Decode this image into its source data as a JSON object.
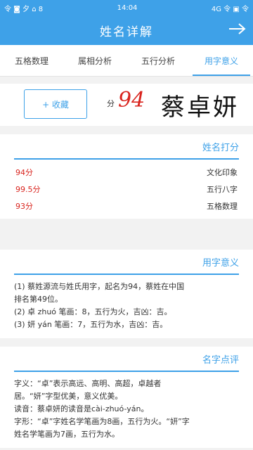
{
  "status_bar": {
    "left": "4G 令 ▣ 令",
    "time": "14:04",
    "right": "令 ◙ 夕 ⌂ 8"
  },
  "header": {
    "title": "姓名详解",
    "share_label": "⇧",
    "back_icon": "arrow-right-icon"
  },
  "tabs": [
    "用字意义",
    "五行分析",
    "属相分析",
    "五格数理"
  ],
  "name_card": {
    "favorite_label": "+ 收藏",
    "score": "94",
    "score_unit": "分",
    "name": "蔡卓妍"
  },
  "score_section": {
    "title": "姓名打分",
    "rows": [
      {
        "label": "文化印象",
        "value": "94分"
      },
      {
        "label": "五行八字",
        "value": "99.5分"
      },
      {
        "label": "五格数理",
        "value": "93分"
      }
    ]
  },
  "meaning_section": {
    "title": "用字意义",
    "lines": [
      "(1) 蔡姓源流与姓氏用字，起名为94，蔡姓在中国",
      "排名第49位。",
      "(2) 卓 zhuó 笔画：8，五行为火，吉凶：吉。",
      "(3) 妍 yán 笔画：7，五行为水，吉凶：吉。"
    ]
  },
  "comment_section": {
    "title": "名字点评",
    "lines": [
      "字义：“卓”表示高远、高明、高超，卓越者",
      "居。“妍”字型优美，意义优美。",
      "读音：蔡卓妍的读音是cài-zhuó-yán。",
      "字形：“卓”字姓名学笔画为8画，五行为火。“妍”字",
      "姓名学笔画为7画，五行为水。"
    ]
  }
}
